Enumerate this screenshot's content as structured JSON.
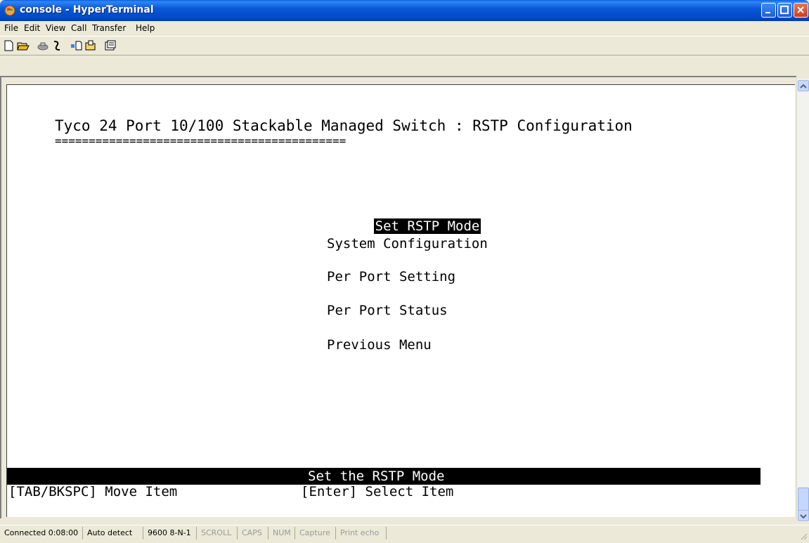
{
  "window": {
    "title": "console - HyperTerminal"
  },
  "menu": {
    "items": [
      "File",
      "Edit",
      "View",
      "Call",
      "Transfer",
      "Help"
    ]
  },
  "toolbar": {
    "icons": [
      "new-icon",
      "open-icon",
      "call-icon",
      "disconnect-icon",
      "send-icon",
      "receive-icon",
      "properties-icon"
    ]
  },
  "terminal": {
    "header": "Tyco 24 Port 10/100 Stackable Managed Switch : RSTP Configuration",
    "underline": "===========================================",
    "options": [
      {
        "label": "Set RSTP Mode",
        "selected": true
      },
      {
        "label": "System Configuration",
        "selected": false
      },
      {
        "label": "Per Port Setting",
        "selected": false
      },
      {
        "label": "Per Port Status",
        "selected": false
      },
      {
        "label": "Previous Menu",
        "selected": false
      }
    ],
    "status_message": "Set the RSTP Mode",
    "hint_left": "[TAB/BKSPC] Move Item",
    "hint_right": "[Enter] Select Item"
  },
  "statusbar": {
    "connected": "Connected 0:08:00",
    "detect": "Auto detect",
    "settings": "9600 8-N-1",
    "scroll": "SCROLL",
    "caps": "CAPS",
    "num": "NUM",
    "capture": "Capture",
    "print_echo": "Print echo"
  },
  "colors": {
    "titlebar": "#0a58d8",
    "selected_bg": "#000000",
    "terminal_bg": "#ffffff"
  }
}
